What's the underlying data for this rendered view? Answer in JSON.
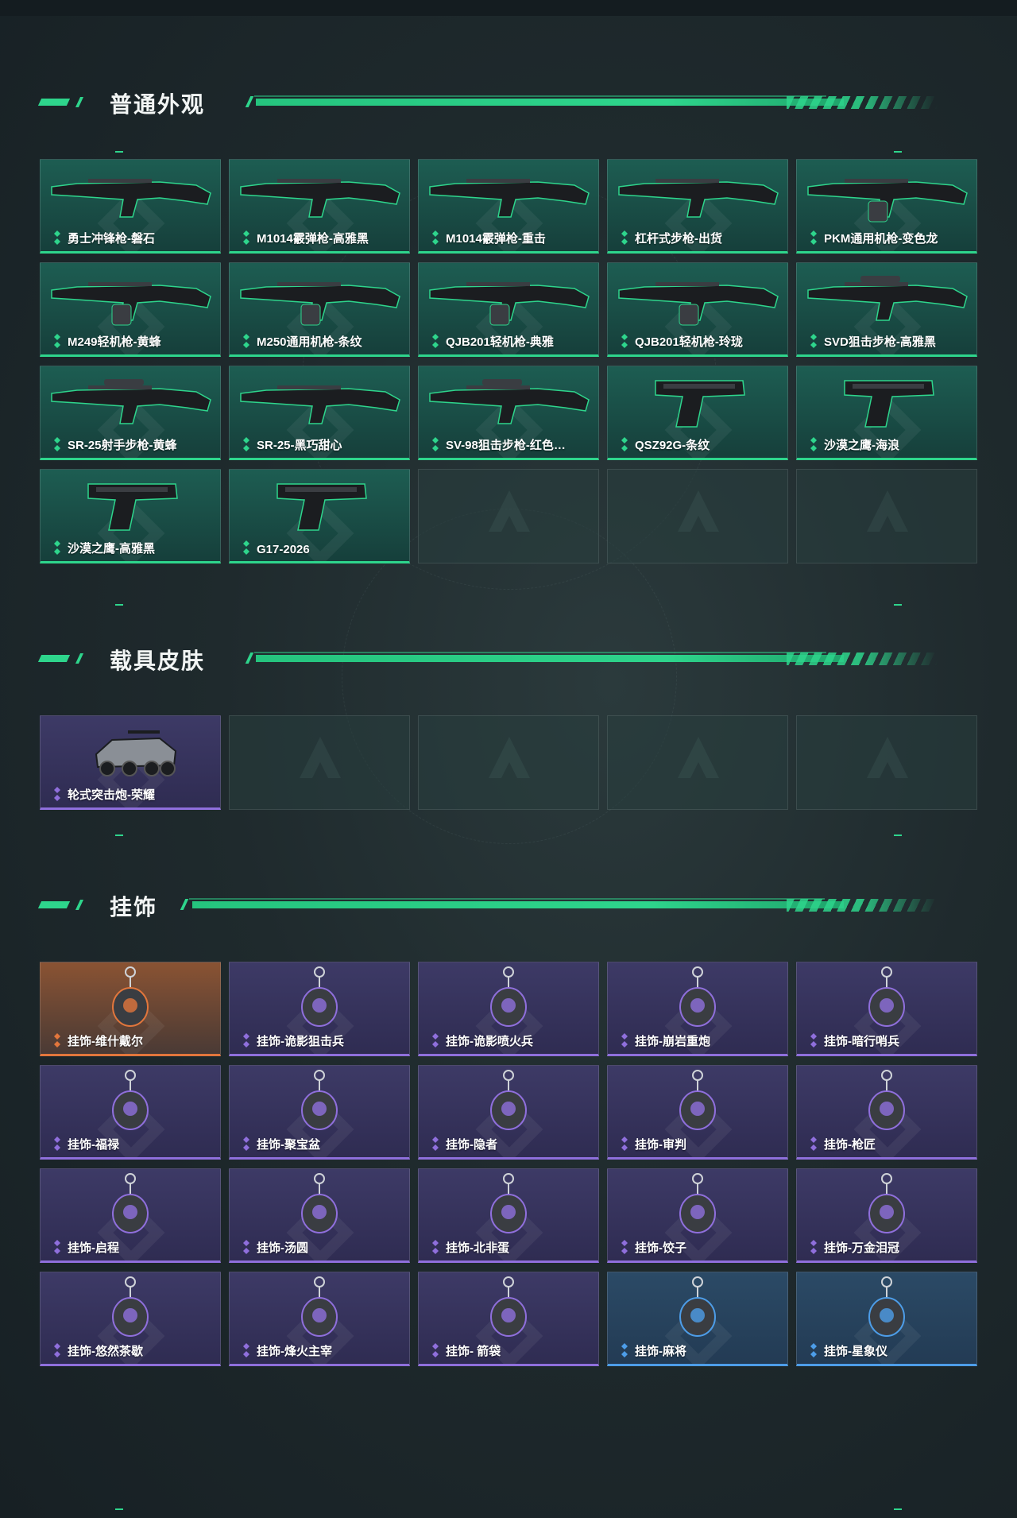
{
  "sections": {
    "skins": {
      "title": "普通外观",
      "items": [
        {
          "label": "勇士冲锋枪-磐石",
          "rarity": "green",
          "icon": "smg-icon"
        },
        {
          "label": "M1014霰弹枪-高雅黑",
          "rarity": "green",
          "icon": "shotgun-icon"
        },
        {
          "label": "M1014霰弹枪-重击",
          "rarity": "green",
          "icon": "shotgun-icon"
        },
        {
          "label": "杠杆式步枪-出货",
          "rarity": "green",
          "icon": "rifle-icon"
        },
        {
          "label": "PKM通用机枪-变色龙",
          "rarity": "green",
          "icon": "machine-gun-icon"
        },
        {
          "label": "M249轻机枪-黄蜂",
          "rarity": "green",
          "icon": "machine-gun-icon"
        },
        {
          "label": "M250通用机枪-条纹",
          "rarity": "green",
          "icon": "machine-gun-icon"
        },
        {
          "label": "QJB201轻机枪-典雅",
          "rarity": "green",
          "icon": "machine-gun-icon"
        },
        {
          "label": "QJB201轻机枪-玲珑",
          "rarity": "green",
          "icon": "machine-gun-icon"
        },
        {
          "label": "SVD狙击步枪-高雅黑",
          "rarity": "green",
          "icon": "sniper-icon"
        },
        {
          "label": "SR-25射手步枪-黄蜂",
          "rarity": "green",
          "icon": "sniper-icon"
        },
        {
          "label": "SR-25-黑巧甜心",
          "rarity": "green",
          "icon": "rifle-icon"
        },
        {
          "label": "SV-98狙击步枪-红色…",
          "rarity": "green",
          "icon": "sniper-icon"
        },
        {
          "label": "QSZ92G-条纹",
          "rarity": "green",
          "icon": "pistol-icon"
        },
        {
          "label": "沙漠之鹰-海浪",
          "rarity": "green",
          "icon": "pistol-icon"
        },
        {
          "label": "沙漠之鹰-高雅黑",
          "rarity": "green",
          "icon": "pistol-icon"
        },
        {
          "label": "G17-2026",
          "rarity": "green",
          "icon": "pistol-icon"
        }
      ],
      "empty_slots": 3
    },
    "vehicles": {
      "title": "载具皮肤",
      "items": [
        {
          "label": "轮式突击炮-荣耀",
          "rarity": "purple",
          "icon": "vehicle-icon"
        }
      ],
      "empty_slots": 4
    },
    "charms": {
      "title": "挂饰",
      "items": [
        {
          "label": "挂饰-维什戴尔",
          "rarity": "orange",
          "icon": "charm-icon"
        },
        {
          "label": "挂饰-诡影狙击兵",
          "rarity": "purple",
          "icon": "charm-icon"
        },
        {
          "label": "挂饰-诡影喷火兵",
          "rarity": "purple",
          "icon": "charm-icon"
        },
        {
          "label": "挂饰-崩岩重炮",
          "rarity": "purple",
          "icon": "charm-icon"
        },
        {
          "label": "挂饰-暗行哨兵",
          "rarity": "purple",
          "icon": "charm-icon"
        },
        {
          "label": "挂饰-福禄",
          "rarity": "purple",
          "icon": "charm-icon"
        },
        {
          "label": "挂饰-聚宝盆",
          "rarity": "purple",
          "icon": "charm-icon"
        },
        {
          "label": "挂饰-隐者",
          "rarity": "purple",
          "icon": "charm-icon"
        },
        {
          "label": "挂饰-审判",
          "rarity": "purple",
          "icon": "charm-icon"
        },
        {
          "label": "挂饰-枪匠",
          "rarity": "purple",
          "icon": "charm-icon"
        },
        {
          "label": "挂饰-启程",
          "rarity": "purple",
          "icon": "charm-icon"
        },
        {
          "label": "挂饰-汤圆",
          "rarity": "purple",
          "icon": "charm-icon"
        },
        {
          "label": "挂饰-北非蛋",
          "rarity": "purple",
          "icon": "charm-icon"
        },
        {
          "label": "挂饰-饺子",
          "rarity": "purple",
          "icon": "charm-icon"
        },
        {
          "label": "挂饰-万金泪冠",
          "rarity": "purple",
          "icon": "charm-icon"
        },
        {
          "label": "挂饰-悠然茶歇",
          "rarity": "purple",
          "icon": "charm-icon"
        },
        {
          "label": "挂饰-烽火主宰",
          "rarity": "purple",
          "icon": "charm-icon"
        },
        {
          "label": "挂饰- 箭袋",
          "rarity": "purple",
          "icon": "charm-icon"
        },
        {
          "label": "挂饰-麻将",
          "rarity": "blue",
          "icon": "charm-icon"
        },
        {
          "label": "挂饰-星象仪",
          "rarity": "blue",
          "icon": "charm-icon"
        }
      ],
      "empty_slots": 0
    }
  },
  "colors": {
    "accent": "#2ed58c",
    "green": "#2ed58c",
    "purple": "#8f6fdc",
    "orange": "#e2763c",
    "blue": "#4d9de8"
  }
}
